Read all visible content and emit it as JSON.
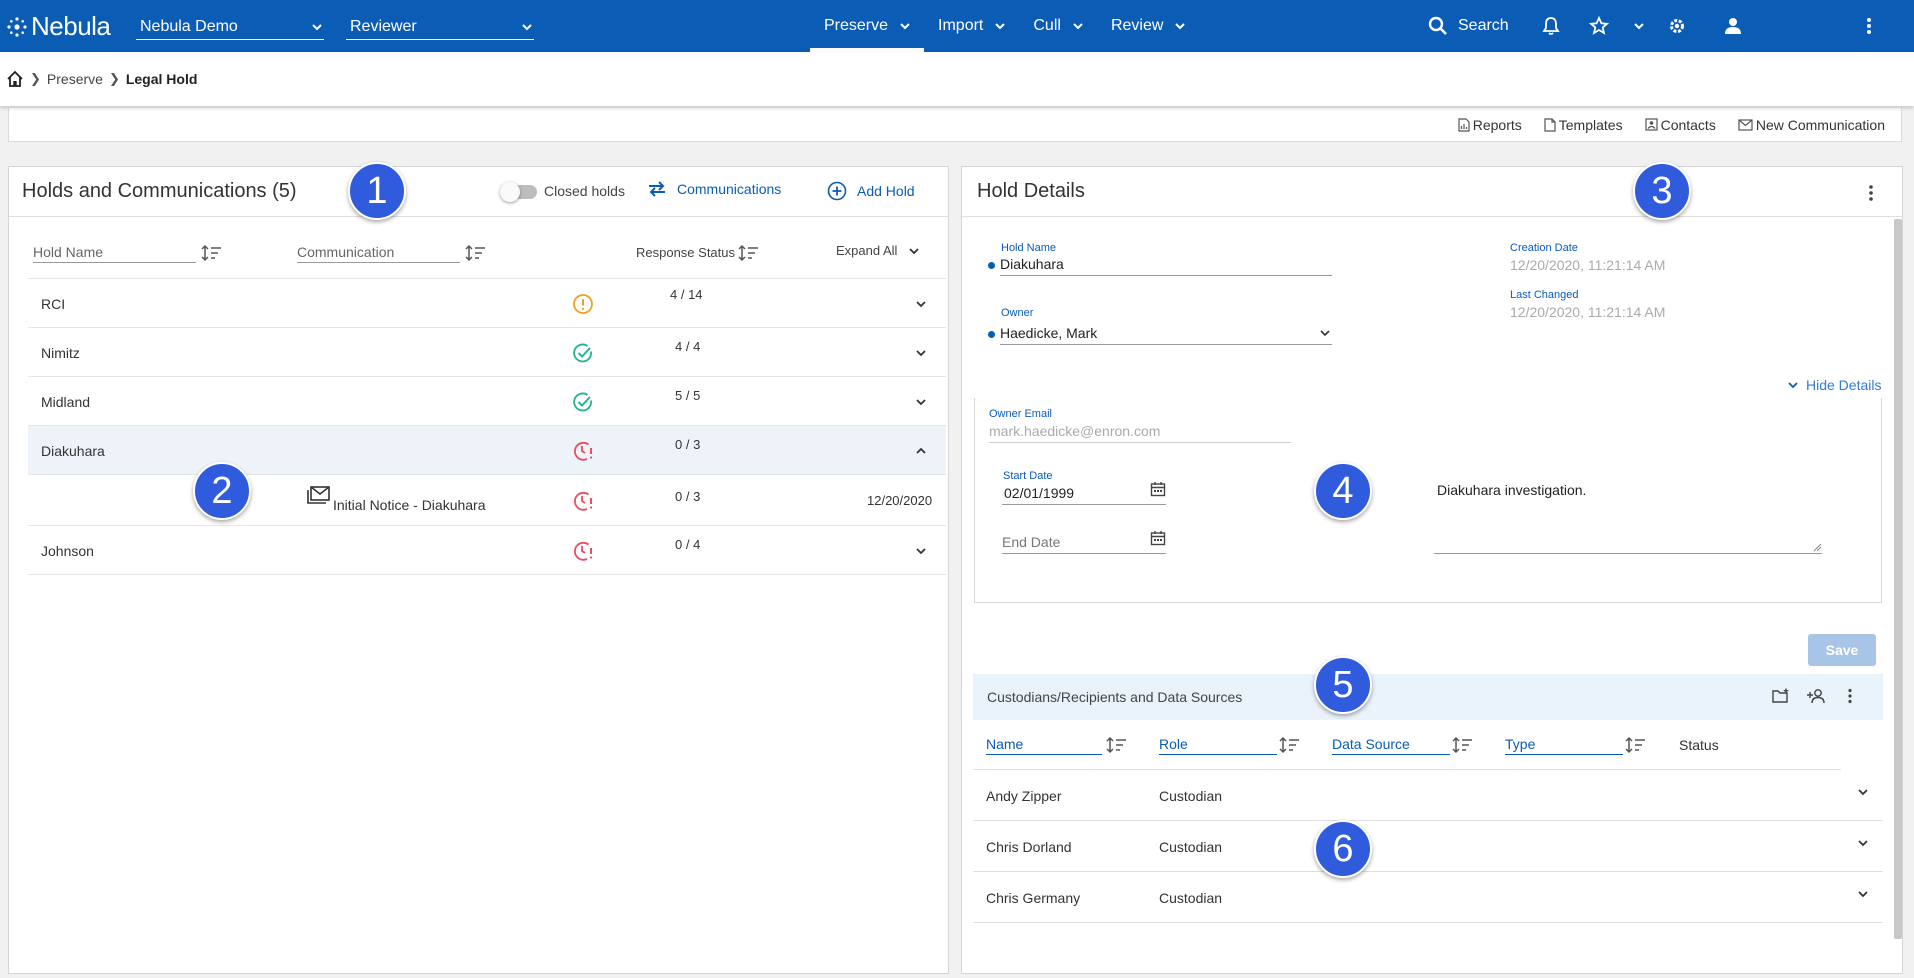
{
  "app": {
    "name": "Nebula"
  },
  "header": {
    "project_select": "Nebula Demo",
    "role_select": "Reviewer",
    "nav": [
      "Preserve",
      "Import",
      "Cull",
      "Review"
    ],
    "search_label": "Search"
  },
  "breadcrumb": {
    "parent": "Preserve",
    "current": "Legal Hold"
  },
  "actions": [
    "Reports",
    "Templates",
    "Contacts",
    "New Communication"
  ],
  "holds_panel": {
    "title": "Holds and Communications (5)",
    "closed_holds_label": "Closed holds",
    "communications_label": "Communications",
    "add_hold_label": "Add Hold",
    "columns": {
      "hold_name": "Hold Name",
      "communication": "Communication",
      "response_status": "Response Status",
      "expand_all": "Expand All"
    },
    "rows": [
      {
        "name": "RCI",
        "status": "warning",
        "response": "4 / 14"
      },
      {
        "name": "Nimitz",
        "status": "complete",
        "response": "4 / 4"
      },
      {
        "name": "Midland",
        "status": "complete",
        "response": "5 / 5"
      },
      {
        "name": "Diakuhara",
        "status": "overdue",
        "response": "0 / 3"
      },
      {
        "name": "Johnson",
        "status": "overdue",
        "response": "0 / 4"
      }
    ],
    "sub_row": {
      "communication": "Initial Notice - Diakuhara",
      "response": "0 / 3",
      "date": "12/20/2020"
    }
  },
  "details_panel": {
    "title": "Hold Details",
    "hold_name_label": "Hold Name",
    "hold_name": "Diakuhara",
    "owner_label": "Owner",
    "owner": "Haedicke, Mark",
    "creation_date_label": "Creation Date",
    "creation_date": "12/20/2020, 11:21:14 AM",
    "last_changed_label": "Last Changed",
    "last_changed": "12/20/2020, 11:21:14 AM",
    "hide_details": "Hide Details",
    "owner_email_label": "Owner Email",
    "owner_email": "mark.haedicke@enron.com",
    "start_date_label": "Start Date",
    "start_date": "02/01/1999",
    "end_date_placeholder": "End Date",
    "description": "Diakuhara investigation.",
    "save_label": "Save"
  },
  "custodians": {
    "title": "Custodians/Recipients and Data Sources",
    "columns": {
      "name": "Name",
      "role": "Role",
      "data_source": "Data Source",
      "type": "Type",
      "status": "Status"
    },
    "rows": [
      {
        "name": "Andy Zipper",
        "role": "Custodian"
      },
      {
        "name": "Chris Dorland",
        "role": "Custodian"
      },
      {
        "name": "Chris Germany",
        "role": "Custodian"
      }
    ]
  },
  "markers": [
    "1",
    "2",
    "3",
    "4",
    "5",
    "6"
  ],
  "colors": {
    "primary": "#0a5cb4",
    "marker": "#2f5bdc",
    "warning": "#f0a020",
    "complete": "#1fb58f",
    "overdue": "#e84d62"
  }
}
